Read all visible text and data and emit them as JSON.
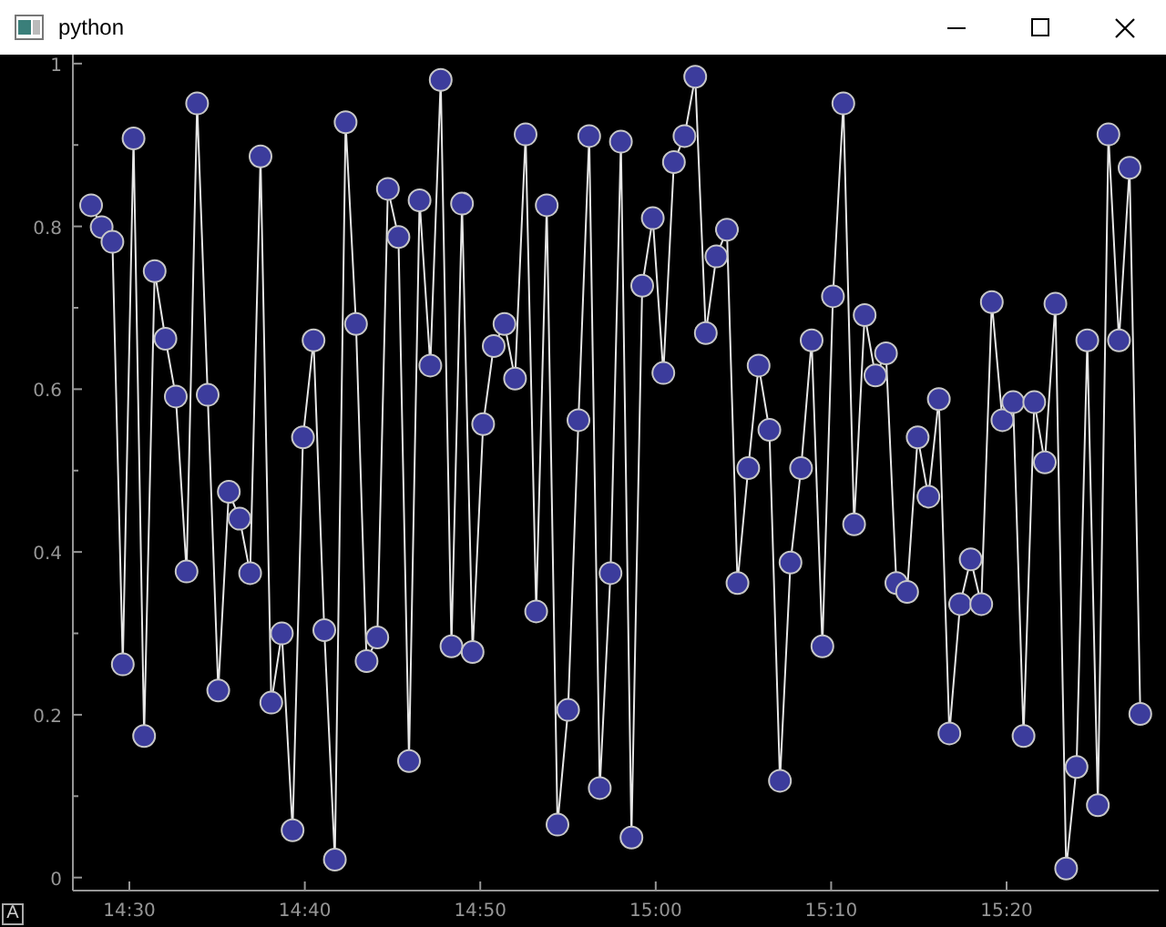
{
  "window": {
    "title": "python"
  },
  "plot": {
    "chart_data": {
      "type": "line",
      "x": [
        867.82,
        868.42,
        869.03,
        869.63,
        870.24,
        870.84,
        871.44,
        872.05,
        872.65,
        873.26,
        873.86,
        874.46,
        875.07,
        875.67,
        876.28,
        876.88,
        877.48,
        878.09,
        878.69,
        879.3,
        879.9,
        880.5,
        881.11,
        881.71,
        882.32,
        882.92,
        883.52,
        884.13,
        884.73,
        885.34,
        885.94,
        886.54,
        887.15,
        887.75,
        888.36,
        888.96,
        889.56,
        890.17,
        890.77,
        891.38,
        891.98,
        892.58,
        893.19,
        893.79,
        894.4,
        895.0,
        895.6,
        896.21,
        896.81,
        897.42,
        898.02,
        898.62,
        899.23,
        899.83,
        900.44,
        901.04,
        901.64,
        902.25,
        902.85,
        903.46,
        904.06,
        904.66,
        905.27,
        905.87,
        906.48,
        907.08,
        907.68,
        908.29,
        908.89,
        909.5,
        910.1,
        910.7,
        911.31,
        911.91,
        912.52,
        913.12,
        913.72,
        914.33,
        914.93,
        915.54,
        916.14,
        916.74,
        917.35,
        917.95,
        918.56,
        919.16,
        919.76,
        920.37,
        920.97,
        921.58,
        922.18,
        922.78,
        923.39,
        923.99,
        924.6,
        925.2,
        925.8,
        926.41,
        927.01,
        927.62
      ],
      "series": [
        {
          "color": "#3c3c9c",
          "marker": "circle",
          "values": [
            0.826,
            0.799,
            0.781,
            0.262,
            0.908,
            0.174,
            0.745,
            0.662,
            0.591,
            0.376,
            0.951,
            0.593,
            0.23,
            0.474,
            0.441,
            0.374,
            0.886,
            0.215,
            0.3,
            0.058,
            0.541,
            0.66,
            0.304,
            0.022,
            0.928,
            0.68,
            0.266,
            0.295,
            0.846,
            0.787,
            0.143,
            0.832,
            0.629,
            0.98,
            0.284,
            0.828,
            0.277,
            0.557,
            0.653,
            0.68,
            0.613,
            0.913,
            0.327,
            0.826,
            0.065,
            0.206,
            0.562,
            0.911,
            0.11,
            0.374,
            0.904,
            0.049,
            0.727,
            0.81,
            0.62,
            0.879,
            0.911,
            0.984,
            0.669,
            0.763,
            0.796,
            0.362,
            0.503,
            0.629,
            0.55,
            0.119,
            0.387,
            0.503,
            0.66,
            0.284,
            0.714,
            0.951,
            0.434,
            0.691,
            0.617,
            0.644,
            0.362,
            0.351,
            0.541,
            0.468,
            0.588,
            0.177,
            0.336,
            0.391,
            0.336,
            0.707,
            0.562,
            0.584,
            0.174,
            0.584,
            0.51,
            0.705,
            0.011,
            0.136,
            0.66,
            0.089,
            0.913,
            0.66,
            0.872,
            0.201
          ]
        }
      ],
      "xlim": [
        866.78,
        928.67
      ],
      "ylim": [
        -0.016,
        1.011
      ],
      "xticks": [
        {
          "value": 870,
          "label": "14:30"
        },
        {
          "value": 880,
          "label": "14:40"
        },
        {
          "value": 890,
          "label": "14:50"
        },
        {
          "value": 900,
          "label": "15:00"
        },
        {
          "value": 910,
          "label": "15:10"
        },
        {
          "value": 920,
          "label": "15:20"
        }
      ],
      "yticks": [
        {
          "value": 0,
          "label": "0"
        },
        {
          "value": 0.2,
          "label": "0.2"
        },
        {
          "value": 0.4,
          "label": "0.4"
        },
        {
          "value": 0.6,
          "label": "0.6"
        },
        {
          "value": 0.8,
          "label": "0.8"
        },
        {
          "value": 1,
          "label": "1"
        }
      ]
    },
    "auto_range_button": "A"
  }
}
